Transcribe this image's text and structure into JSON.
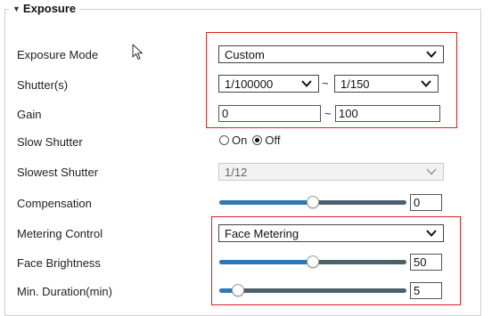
{
  "section": {
    "title": "Exposure"
  },
  "exposure_mode": {
    "label": "Exposure Mode",
    "value": "Custom"
  },
  "shutter": {
    "label": "Shutter(s)",
    "min": "1/100000",
    "separator": "~",
    "max": "1/150"
  },
  "gain": {
    "label": "Gain",
    "min": "0",
    "separator": "~",
    "max": "100"
  },
  "slow_shutter": {
    "label": "Slow Shutter",
    "on_label": "On",
    "off_label": "Off",
    "selected": "Off"
  },
  "slowest_shutter": {
    "label": "Slowest Shutter",
    "value": "1/12",
    "disabled": true
  },
  "compensation": {
    "label": "Compensation",
    "value": "0",
    "level": 0.5
  },
  "metering_control": {
    "label": "Metering Control",
    "value": "Face Metering"
  },
  "face_brightness": {
    "label": "Face Brightness",
    "value": "50",
    "level": 0.5
  },
  "min_duration": {
    "label": "Min. Duration(min)",
    "value": "5",
    "level": 0.1
  },
  "colors": {
    "highlight": "#e02020",
    "slider_fill": "#2f78b8",
    "slider_track": "#4e5f6c"
  }
}
